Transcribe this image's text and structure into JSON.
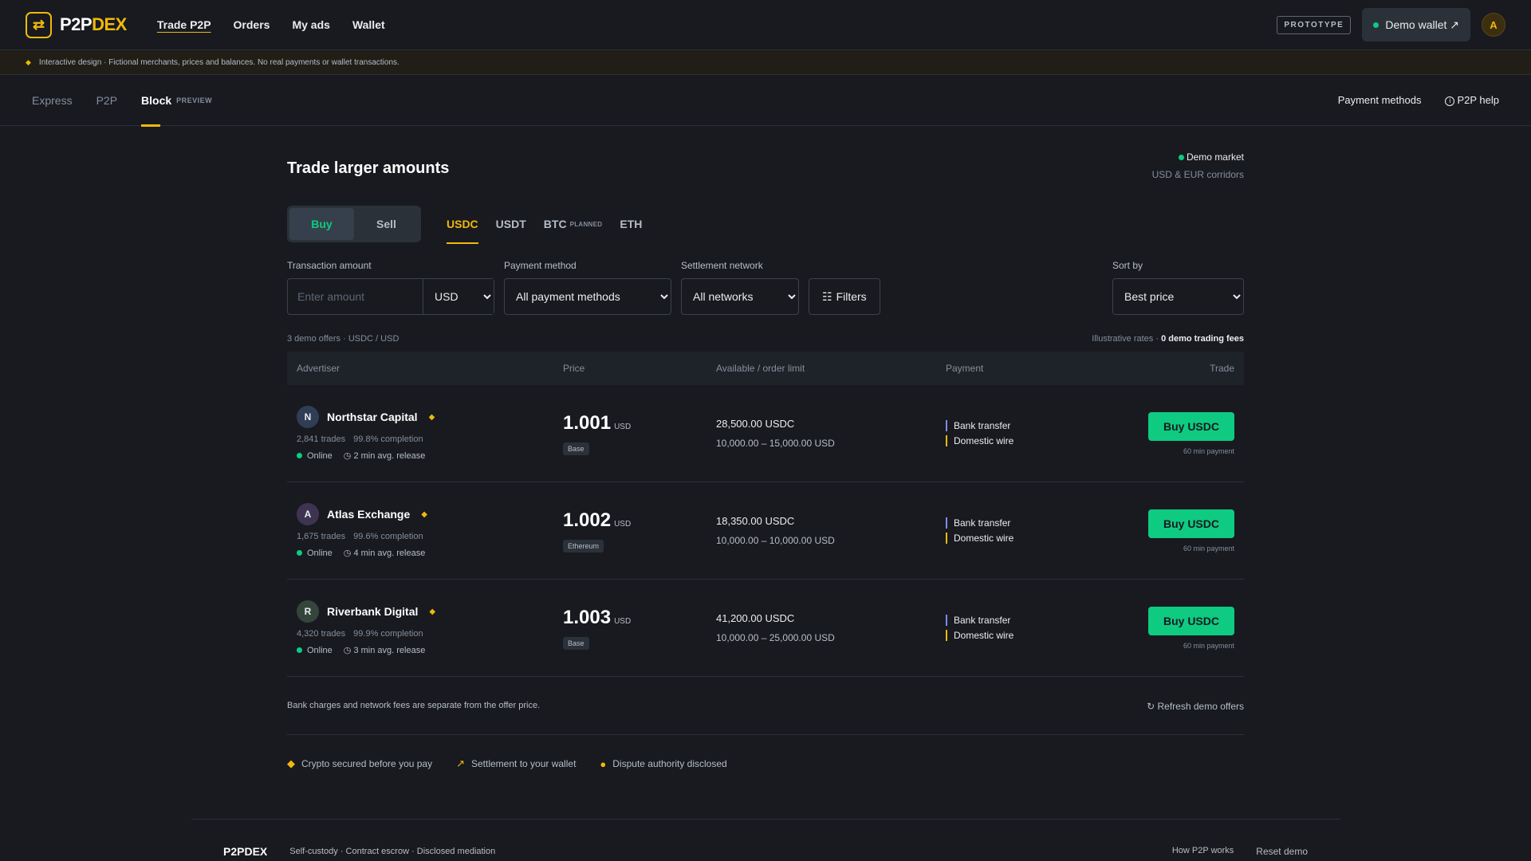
{
  "header": {
    "logo_p2p": "P2P",
    "logo_dex": "DEX",
    "nav": [
      "Trade P2P",
      "Orders",
      "My ads",
      "Wallet"
    ],
    "prototype_badge": "PROTOTYPE",
    "wallet_label": "Demo wallet ↗",
    "avatar_initial": "A"
  },
  "notice": "Interactive design · Fictional merchants, prices and balances. No real payments or wallet transactions.",
  "subnav": {
    "tabs": [
      "Express",
      "P2P",
      "Block"
    ],
    "preview_tag": "PREVIEW",
    "payment_methods": "Payment methods",
    "help": "P2P help"
  },
  "main": {
    "title": "Trade larger amounts",
    "market_status": "Demo market",
    "market_sub": "USD & EUR corridors",
    "buy_label": "Buy",
    "sell_label": "Sell",
    "coins": [
      "USDC",
      "USDT",
      "BTC",
      "ETH"
    ],
    "planned_tag": "PLANNED"
  },
  "filters": {
    "amount_label": "Transaction amount",
    "amount_placeholder": "Enter amount",
    "currency": "USD",
    "payment_label": "Payment method",
    "payment_value": "All payment methods",
    "network_label": "Settlement network",
    "network_value": "All networks",
    "filters_btn": "Filters",
    "sort_label": "Sort by",
    "sort_value": "Best price"
  },
  "meta": {
    "count": "3 demo offers · USDC / USD",
    "rates": "Illustrative rates · ",
    "fees": "0 demo trading fees"
  },
  "table": {
    "headers": [
      "Advertiser",
      "Price",
      "Available / order limit",
      "Payment",
      "Trade"
    ],
    "rows": [
      {
        "initial": "N",
        "avatar_color": "#2f3e55",
        "name": "Northstar Capital",
        "trades": "2,841 trades",
        "completion": "99.8% completion",
        "online": "Online",
        "release": "2 min avg. release",
        "price": "1.001",
        "price_cur": "USD",
        "network": "Base",
        "available": "28,500.00 USDC",
        "limit": "10,000.00 – 15,000.00 USD",
        "pay1": "Bank transfer",
        "pay2": "Domestic wire",
        "button": "Buy USDC",
        "pay_time": "60 min payment"
      },
      {
        "initial": "A",
        "avatar_color": "#3e3452",
        "name": "Atlas Exchange",
        "trades": "1,675 trades",
        "completion": "99.6% completion",
        "online": "Online",
        "release": "4 min avg. release",
        "price": "1.002",
        "price_cur": "USD",
        "network": "Ethereum",
        "available": "18,350.00 USDC",
        "limit": "10,000.00 – 10,000.00 USD",
        "pay1": "Bank transfer",
        "pay2": "Domestic wire",
        "button": "Buy USDC",
        "pay_time": "60 min payment"
      },
      {
        "initial": "R",
        "avatar_color": "#34463c",
        "name": "Riverbank Digital",
        "trades": "4,320 trades",
        "completion": "99.9% completion",
        "online": "Online",
        "release": "3 min avg. release",
        "price": "1.003",
        "price_cur": "USD",
        "network": "Base",
        "available": "41,200.00 USDC",
        "limit": "10,000.00 – 25,000.00 USD",
        "pay1": "Bank transfer",
        "pay2": "Domestic wire",
        "button": "Buy USDC",
        "pay_time": "60 min payment"
      }
    ]
  },
  "note": "Bank charges and network fees are separate from the offer price.",
  "refresh": "↻ Refresh demo offers",
  "features": [
    "Crypto secured before you pay",
    "Settlement to your wallet",
    "Dispute authority disclosed"
  ],
  "footer": {
    "logo": "P2PDEX",
    "tagline": "Self-custody · Contract escrow · Disclosed mediation",
    "how": "How P2P works",
    "reset": "Reset demo"
  },
  "colors": {
    "accent": "#f0b90b",
    "buy_green": "#0ecb81",
    "background": "#181a20",
    "bank_transfer_bar": "#7b8cff",
    "domestic_wire_bar": "#f0b90b"
  }
}
